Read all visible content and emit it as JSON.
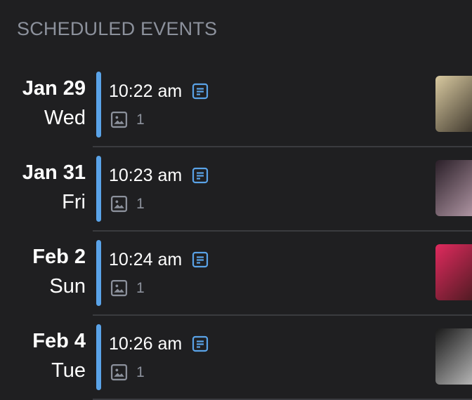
{
  "section": {
    "title": "SCHEDULED EVENTS"
  },
  "colors": {
    "background": "#1f1f21",
    "accent": "#5aa3e8",
    "muted_text": "#8c919c",
    "divider": "#3a3b3f"
  },
  "events": [
    {
      "date": "Jan 29",
      "weekday": "Wed",
      "time": "10:22 am",
      "note_icon": "note-icon",
      "media_icon": "image-icon",
      "media_count": "1",
      "thumbnail_colors": [
        "#d8c9a0",
        "#3b342a"
      ]
    },
    {
      "date": "Jan 31",
      "weekday": "Fri",
      "time": "10:23 am",
      "note_icon": "note-icon",
      "media_icon": "image-icon",
      "media_count": "1",
      "thumbnail_colors": [
        "#2a1f28",
        "#b59aa8"
      ]
    },
    {
      "date": "Feb 2",
      "weekday": "Sun",
      "time": "10:24 am",
      "note_icon": "note-icon",
      "media_icon": "image-icon",
      "media_count": "1",
      "thumbnail_colors": [
        "#e02a5e",
        "#4a1a20"
      ]
    },
    {
      "date": "Feb 4",
      "weekday": "Tue",
      "time": "10:26 am",
      "note_icon": "note-icon",
      "media_icon": "image-icon",
      "media_count": "1",
      "thumbnail_colors": [
        "#1a1a1a",
        "#bdbdbd"
      ]
    }
  ]
}
